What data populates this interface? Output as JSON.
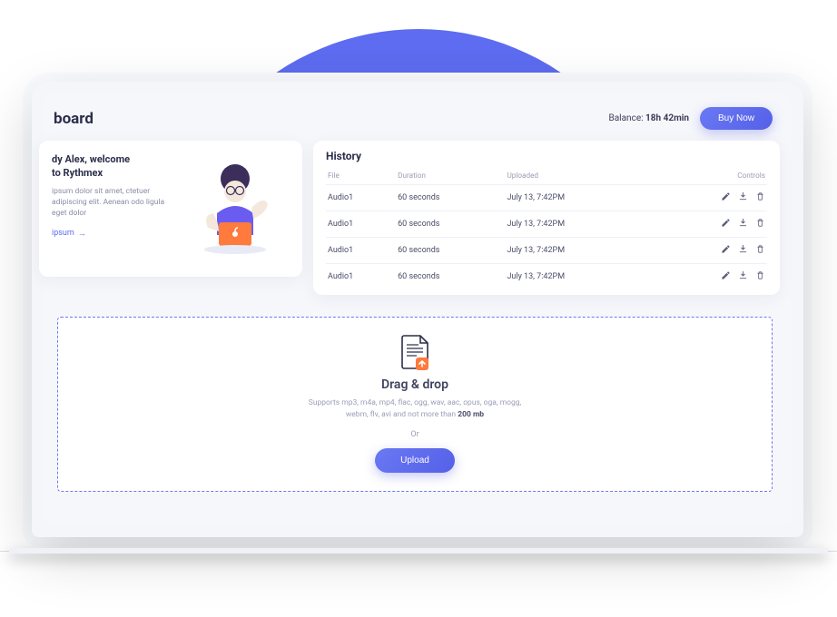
{
  "page_title": "board",
  "balance": {
    "label": "Balance:",
    "value": "18h 42min"
  },
  "buy_now_label": "Buy Now",
  "welcome": {
    "title_line1": "dy Alex, welcome",
    "title_line2": "to Rythmex",
    "body": "ipsum dolor sit amet, ctetuer adipiscing elit. Aenean odo ligula eget dolor",
    "link": "ipsum",
    "link_arrow": "→"
  },
  "history": {
    "title": "History",
    "columns": {
      "file": "File",
      "duration": "Duration",
      "uploaded": "Uploaded",
      "controls": "Controls"
    },
    "rows": [
      {
        "file": "Audio1",
        "duration": "60 seconds",
        "uploaded": "July 13, 7:42PM"
      },
      {
        "file": "Audio1",
        "duration": "60 seconds",
        "uploaded": "July 13, 7:42PM"
      },
      {
        "file": "Audio1",
        "duration": "60 seconds",
        "uploaded": "July 13, 7:42PM"
      },
      {
        "file": "Audio1",
        "duration": "60 seconds",
        "uploaded": "July 13, 7:42PM"
      }
    ]
  },
  "dropzone": {
    "title": "Drag & drop",
    "support_prefix": "Supports mp3, m4a, mp4, flac, ogg, wav, aac, opus, oga, mogg, webm, flv, avi and not more than ",
    "support_bold": "200 mb",
    "or": "Or",
    "upload_label": "Upload"
  }
}
